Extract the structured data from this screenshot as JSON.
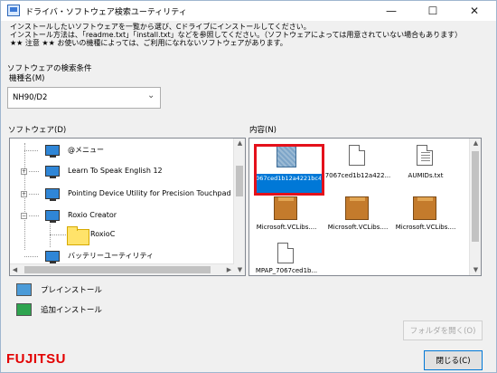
{
  "window": {
    "title": "ドライバ・ソフトウェア検索ユーティリティ",
    "minimize_icon": "minimize-icon",
    "maximize_icon": "maximize-icon",
    "close_icon": "close-icon"
  },
  "description": {
    "line1": "インストールしたいソフトウェアを一覧から選び、Cドライブにインストールしてください。",
    "line2": "インストール方法は、「readme.txt」「install.txt」などを参照してください。（ソフトウェアによっては用意されていない場合もあります）",
    "line3": "★★ 注意 ★★ お使いの機種によっては、ご利用になれないソフトウェアがあります。"
  },
  "search": {
    "label": "ソフトウェアの検索条件",
    "model_label": "機種名(M)",
    "model_value": "NH90/D2"
  },
  "software_panel": {
    "label": "ソフトウェア(D)",
    "items": [
      {
        "label": "@メニュー"
      },
      {
        "label": "Learn To Speak English 12"
      },
      {
        "label": "Pointing Device Utility for Precision Touchpad"
      },
      {
        "label": "Roxio Creator"
      },
      {
        "label": "RoxioC"
      },
      {
        "label": "バッテリーユーティリティ"
      }
    ]
  },
  "contents_panel": {
    "label": "内容(N)",
    "items": [
      {
        "label": "7067ced1b12a4221bc4e9c839225ea4f.appx",
        "icon": "appx-file-icon",
        "selected": true
      },
      {
        "label": "7067ced1b12a422...",
        "icon": "document-icon"
      },
      {
        "label": "AUMIDs.txt",
        "icon": "text-file-icon"
      },
      {
        "label": "Microsoft.VCLibs....",
        "icon": "package-icon"
      },
      {
        "label": "Microsoft.VCLibs....",
        "icon": "package-icon"
      },
      {
        "label": "Microsoft.VCLibs....",
        "icon": "package-icon"
      },
      {
        "label": "MPAP_7067ced1b...",
        "icon": "document-icon"
      }
    ]
  },
  "legend": {
    "preinstall": "プレインストール",
    "add_install": "追加インストール"
  },
  "buttons": {
    "open_folder": "フォルダを開く(O)",
    "close": "閉じる(C)"
  },
  "brand": {
    "logo": "FUJITSU"
  },
  "colors": {
    "accent": "#0078d7",
    "highlight": "#e4111b",
    "brand": "#e30000"
  }
}
